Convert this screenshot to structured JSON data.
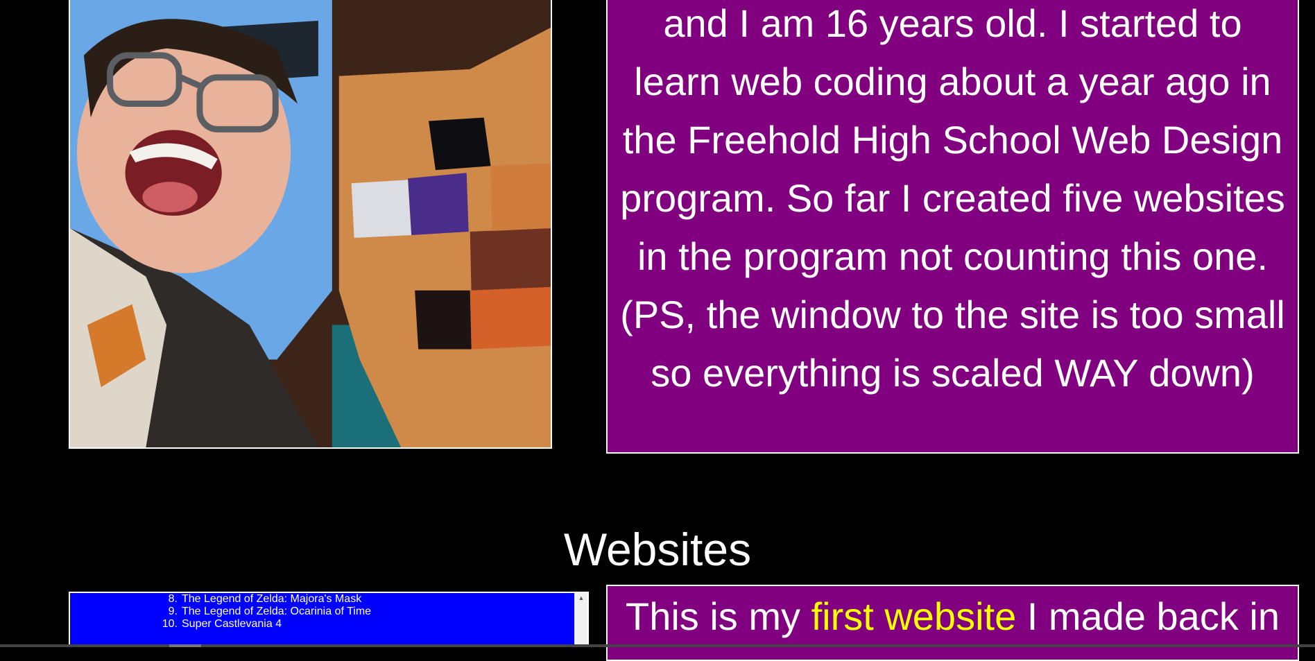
{
  "about": {
    "text": "and I am 16 years old. I started to learn web coding about a year ago in the Freehold High School Web Design program. So far I created five websites in the program not counting this one. (PS, the window to the site is too small so everything is scaled WAY down)"
  },
  "websites_section": {
    "heading": "Websites"
  },
  "first_site_preview": {
    "items": [
      {
        "num": "8.",
        "title": "The Legend of Zelda: Majora's Mask"
      },
      {
        "num": "9.",
        "title": "The Legend of Zelda: Ocarinia of Time"
      },
      {
        "num": "10.",
        "title": "Super Castlevania 4"
      }
    ],
    "scroll_up_icon": "triangle-up"
  },
  "first_site_desc": {
    "before": "This is my ",
    "link": "first website",
    "after": " I made back in"
  },
  "colors": {
    "background": "#000000",
    "panel": "#800080",
    "preview": "#0000ff",
    "link": "#ffff00",
    "text": "#ffffff"
  }
}
